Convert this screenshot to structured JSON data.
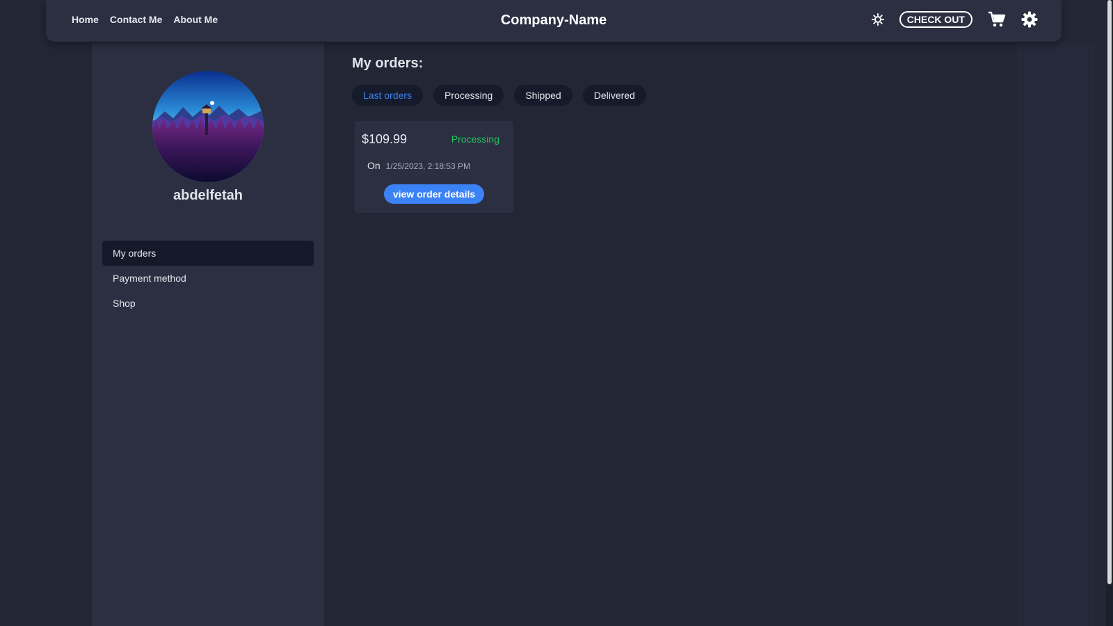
{
  "header": {
    "nav": [
      {
        "label": "Home"
      },
      {
        "label": "Contact Me"
      },
      {
        "label": "About Me"
      }
    ],
    "brand": "Company-Name",
    "checkout_label": "CHECK OUT",
    "icons": [
      "theme-toggle-icon",
      "cart-icon",
      "gear-icon"
    ]
  },
  "sidebar": {
    "username": "abdelfetah",
    "menu": [
      {
        "label": "My orders",
        "active": true
      },
      {
        "label": "Payment method",
        "active": false
      },
      {
        "label": "Shop",
        "active": false
      }
    ]
  },
  "main": {
    "title": "My orders:",
    "filters": [
      {
        "label": "Last orders",
        "active": true
      },
      {
        "label": "Processing",
        "active": false
      },
      {
        "label": "Shipped",
        "active": false
      },
      {
        "label": "Delivered",
        "active": false
      }
    ],
    "orders": [
      {
        "price": "$109.99",
        "status": "Processing",
        "date_prefix": "On",
        "date": "1/25/2023, 2:18:53 PM",
        "button_label": "view order details"
      }
    ]
  },
  "colors": {
    "background": "#232635",
    "panel": "#2c2f41",
    "accent": "#3b82f6",
    "status_processing": "#22c55e"
  }
}
